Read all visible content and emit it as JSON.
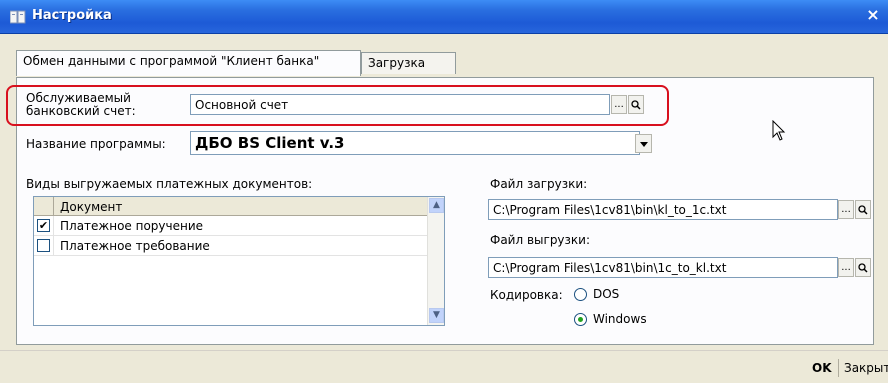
{
  "window": {
    "title": "Настройка",
    "close_glyph": "×"
  },
  "tabs": [
    {
      "label": "Обмен данными с программой \"Клиент банка\""
    },
    {
      "label": "Загрузка"
    }
  ],
  "account": {
    "label": "Обслуживаемый банковский счет:",
    "value": "Основной счет",
    "select_glyph": "...",
    "open_glyph": "Q"
  },
  "program": {
    "label": "Название программы:",
    "value": "ДБО BS Client v.3"
  },
  "documents": {
    "label": "Виды выгружаемых платежных документов:",
    "column": "Документ",
    "rows": [
      {
        "checked": true,
        "name": "Платежное поручение"
      },
      {
        "checked": false,
        "name": "Платежное требование"
      }
    ]
  },
  "import_file": {
    "label": "Файл загрузки:",
    "value": "C:\\Program Files\\1cv81\\bin\\kl_to_1c.txt"
  },
  "export_file": {
    "label": "Файл выгрузки:",
    "value": "C:\\Program Files\\1cv81\\bin\\1c_to_kl.txt"
  },
  "encoding": {
    "label": "Кодировка:",
    "options": [
      {
        "label": "DOS",
        "selected": false
      },
      {
        "label": "Windows",
        "selected": true
      }
    ]
  },
  "buttons": {
    "ok": "OK",
    "close": "Закрыть"
  },
  "colors": {
    "title_bar": "#2a6fe0",
    "highlight_frame": "#d8101e"
  }
}
